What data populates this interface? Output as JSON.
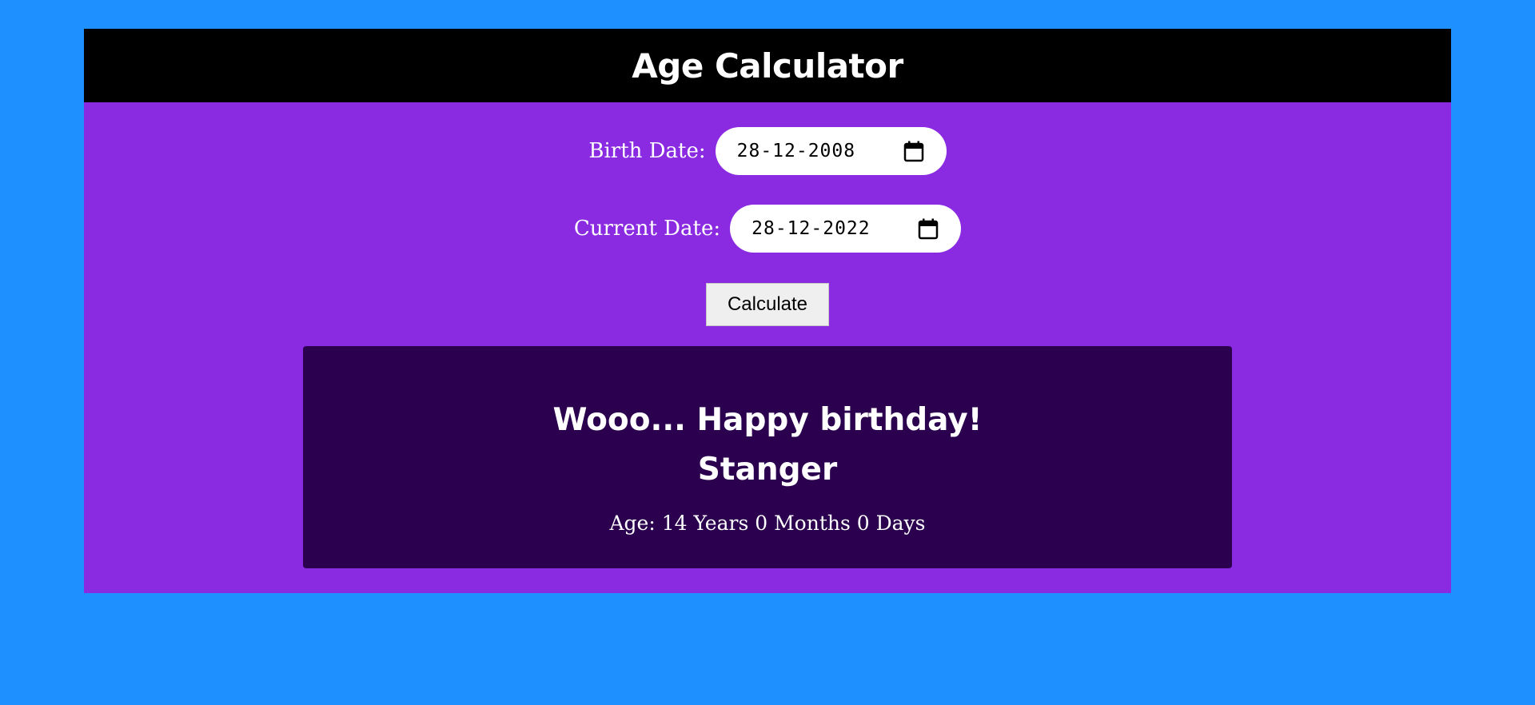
{
  "header": {
    "title": "Age Calculator"
  },
  "form": {
    "birth_label": "Birth Date:",
    "birth_value": "28-12-2008",
    "current_label": "Current Date:",
    "current_value": "28-12-2022",
    "calendar_icon": "calendar-icon",
    "calculate_label": "Calculate"
  },
  "result": {
    "greeting": "Wooo... Happy birthday!",
    "name": "Stanger",
    "age_text": "Age: 14 Years 0 Months 0 Days"
  },
  "colors": {
    "page_background": "#1e90ff",
    "app_background": "#8a2be2",
    "header_background": "#000000",
    "result_background": "#2a004f",
    "button_background": "#efefef"
  }
}
